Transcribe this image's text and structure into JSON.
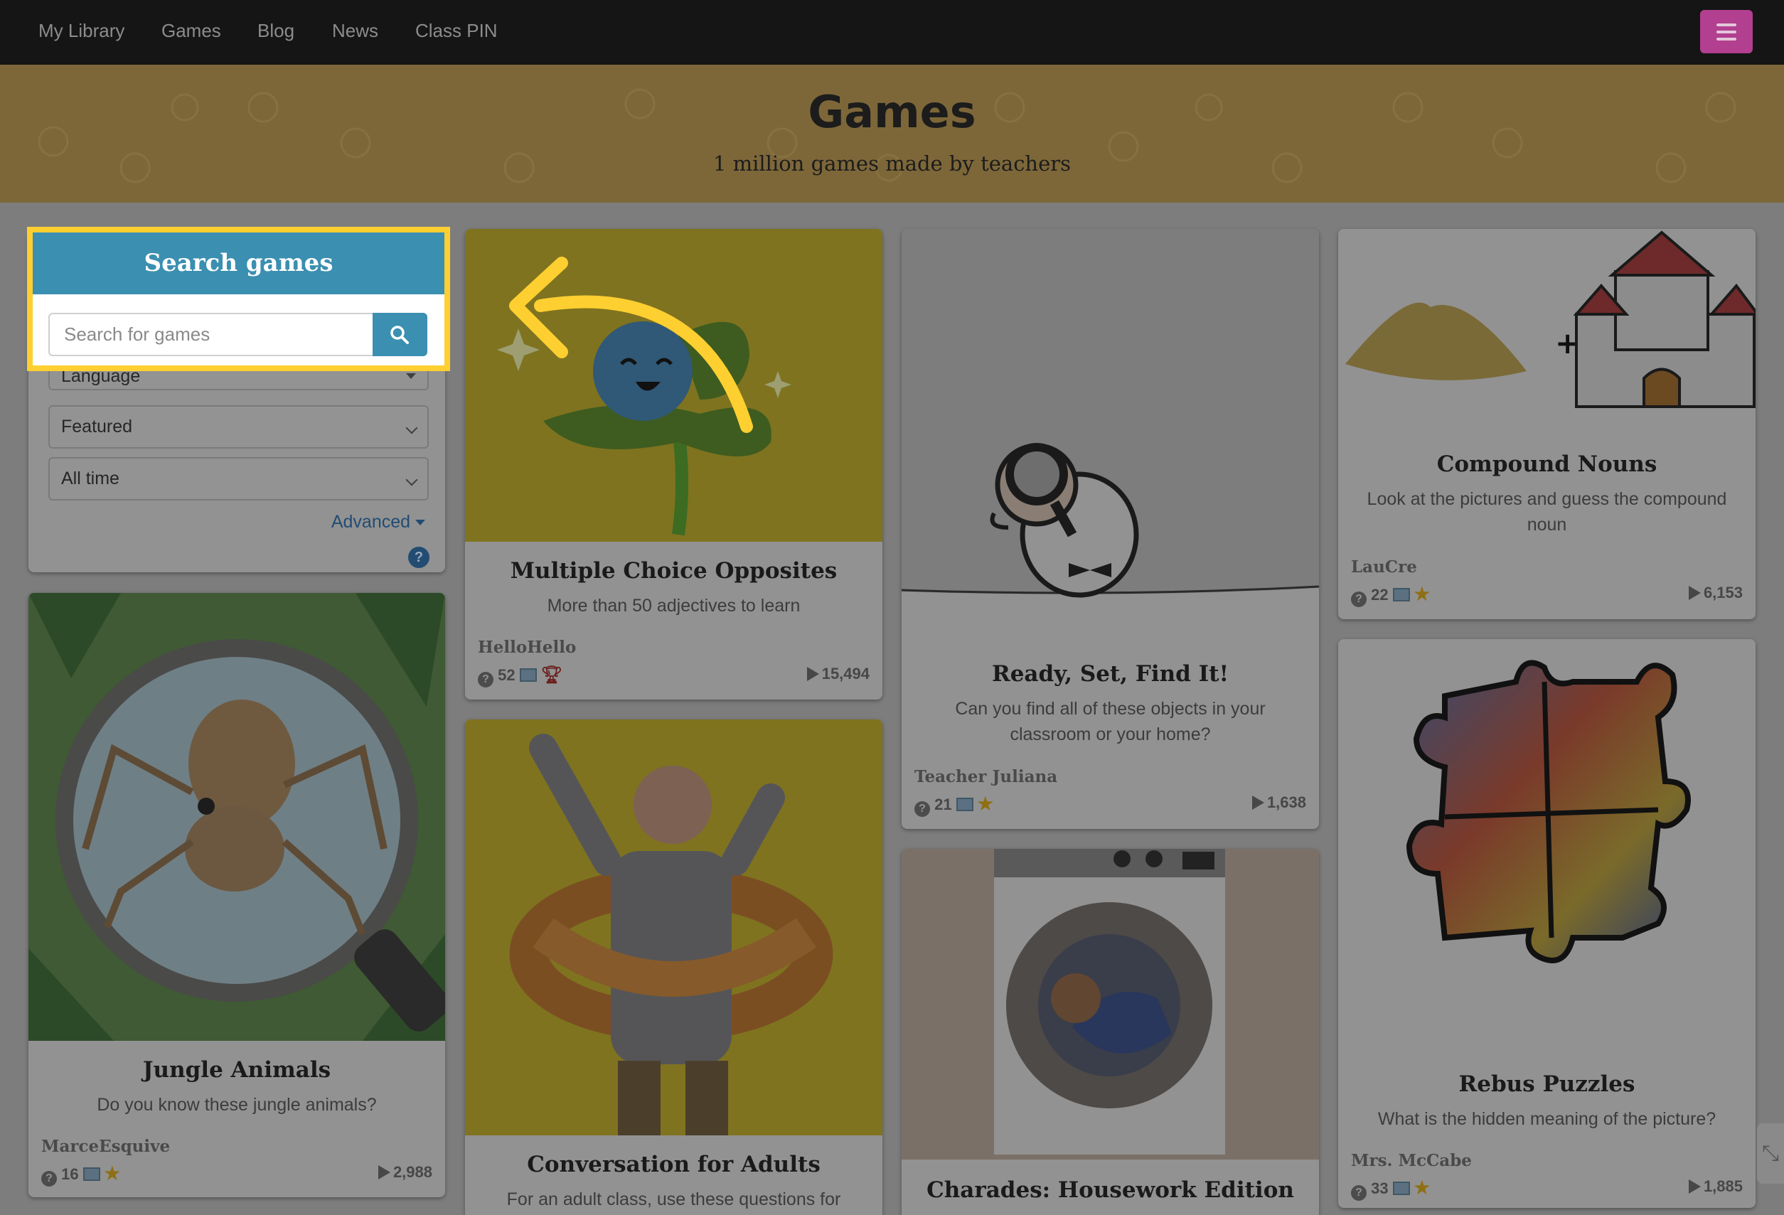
{
  "nav": {
    "links": [
      "My Library",
      "Games",
      "Blog",
      "News",
      "Class PIN"
    ],
    "menu_icon": "hamburger-icon"
  },
  "hero": {
    "title": "Games",
    "subtitle": "1 million games made by teachers"
  },
  "search": {
    "title": "Search games",
    "placeholder": "Search for games",
    "button_icon": "search-icon",
    "language_label": "Language",
    "sort_value": "Featured",
    "time_value": "All time",
    "advanced_label": "Advanced",
    "help_icon": "question-circle-icon",
    "highlight_color": "#FECF30",
    "header_color": "#3B8FB0"
  },
  "cards": [
    {
      "title": "Multiple Choice Opposites",
      "description": "More than 50 adjectives to learn",
      "author": "HelloHello",
      "questions": "52",
      "plays": "15,494",
      "badge": "trophy-icon"
    },
    {
      "title": "Ready, Set, Find It!",
      "description": "Can you find all of these objects in your classroom or your home?",
      "author": "Teacher Juliana",
      "questions": "21",
      "plays": "1,638",
      "badge": "star-icon"
    },
    {
      "title": "Compound Nouns",
      "description": "Look at the pictures and guess the compound noun",
      "author": "LauCre",
      "questions": "22",
      "plays": "6,153",
      "badge": "star-icon"
    },
    {
      "title": "Jungle Animals",
      "description": "Do you know these jungle animals?",
      "author": "MarceEsquive",
      "questions": "16",
      "plays": "2,988",
      "badge": "star-icon"
    },
    {
      "title": "Conversation for Adults",
      "description": "For an adult class, use these questions for"
    },
    {
      "title": "Charades: Housework Edition"
    },
    {
      "title": "Rebus Puzzles",
      "description": "What is the hidden meaning of the picture?",
      "author": "Mrs. McCabe",
      "questions": "33",
      "plays": "1,885",
      "badge": "star-icon"
    }
  ]
}
